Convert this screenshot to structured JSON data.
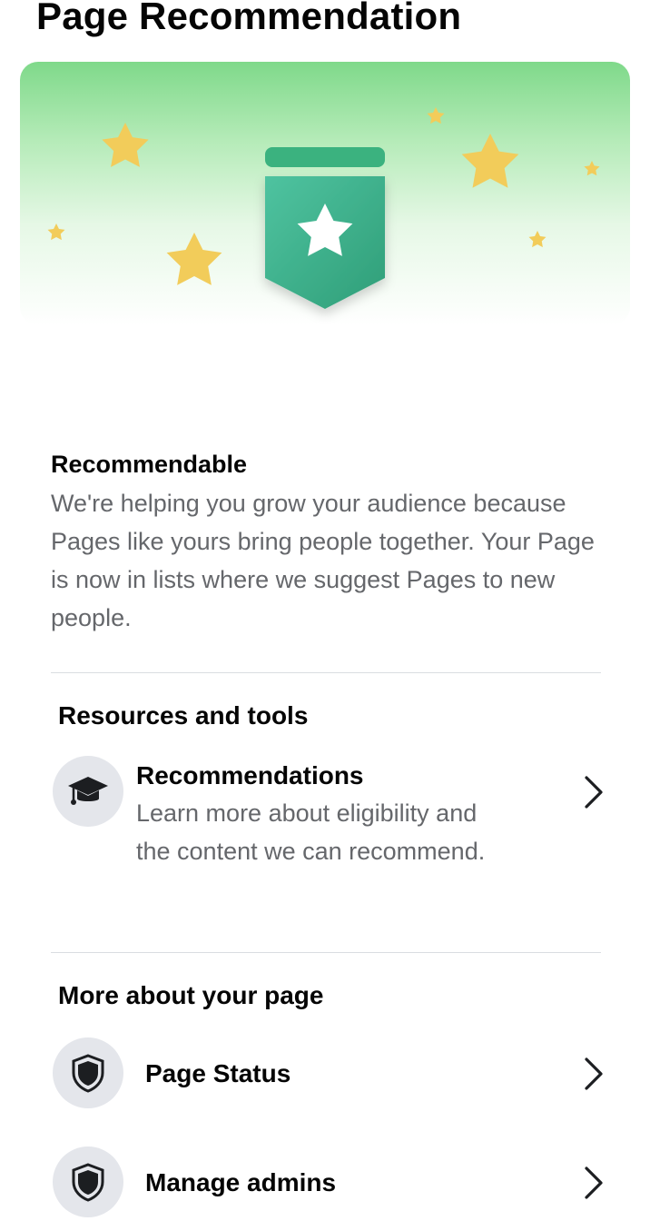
{
  "header": {
    "title": "Page Recommendation"
  },
  "hero": {
    "badge_icon": "star-badge-icon",
    "colors": {
      "badge_top": "#4cc08a",
      "badge_bottom": "#2f9e78",
      "stars": "#f2cc5a",
      "gradient_top": "#7fd98a"
    }
  },
  "status": {
    "title": "Recommendable",
    "description": "We're helping you grow your audience because Pages like yours bring people together. Your Page is now in lists where we suggest Pages to new people."
  },
  "resources": {
    "title": "Resources and tools",
    "items": [
      {
        "icon": "graduation-cap-icon",
        "label": "Recommendations",
        "description": "Learn more about eligibility and the content we can recommend."
      }
    ]
  },
  "more": {
    "title": "More about your page",
    "items": [
      {
        "icon": "shield-icon",
        "label": "Page Status"
      },
      {
        "icon": "shield-icon",
        "label": "Manage admins"
      }
    ]
  }
}
